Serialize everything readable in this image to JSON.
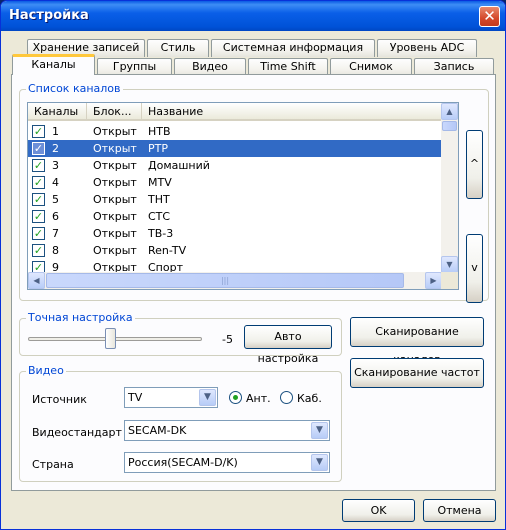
{
  "window": {
    "title": "Настройка"
  },
  "tabs_top": [
    "Хранение записей",
    "Стиль",
    "Системная информация",
    "Уровень ADC"
  ],
  "tabs_bottom": [
    "Каналы",
    "Группы",
    "Видео",
    "Time Shift",
    "Снимок",
    "Запись"
  ],
  "active_tab": "Каналы",
  "channels": {
    "group_label": "Список каналов",
    "columns": [
      "Каналы",
      "Блок...",
      "Название"
    ],
    "rows": [
      {
        "num": "1",
        "block": "Открыт",
        "name": "НТВ",
        "checked": true
      },
      {
        "num": "2",
        "block": "Открыт",
        "name": "РТР",
        "checked": true,
        "selected": true
      },
      {
        "num": "3",
        "block": "Открыт",
        "name": "Домашний",
        "checked": true
      },
      {
        "num": "4",
        "block": "Открыт",
        "name": "MTV",
        "checked": true
      },
      {
        "num": "5",
        "block": "Открыт",
        "name": "ТНТ",
        "checked": true
      },
      {
        "num": "6",
        "block": "Открыт",
        "name": "СТС",
        "checked": true
      },
      {
        "num": "7",
        "block": "Открыт",
        "name": "ТВ-3",
        "checked": true
      },
      {
        "num": "8",
        "block": "Открыт",
        "name": "Ren-TV",
        "checked": true
      },
      {
        "num": "9",
        "block": "Открыт",
        "name": "Спорт",
        "checked": true
      }
    ],
    "up_label": "^",
    "down_label": "v"
  },
  "fine_tune": {
    "group_label": "Точная настройка",
    "value": "-5",
    "auto_button": "Авто настройка"
  },
  "scan_channels_button": "Сканирование каналов",
  "scan_freq_button": "Сканирование частот",
  "video": {
    "group_label": "Видео",
    "source_label": "Источник",
    "source_value": "TV",
    "radio_ant": "Ант.",
    "radio_cab": "Каб.",
    "standard_label": "Видеостандарт",
    "standard_value": "SECAM-DK",
    "country_label": "Страна",
    "country_value": "Россия(SECAM-D/K)"
  },
  "footer": {
    "ok": "OK",
    "cancel": "Отмена"
  },
  "colors": {
    "accent": "#0046d5",
    "selection": "#316ac5",
    "titlebar": "#0a5fe8"
  }
}
